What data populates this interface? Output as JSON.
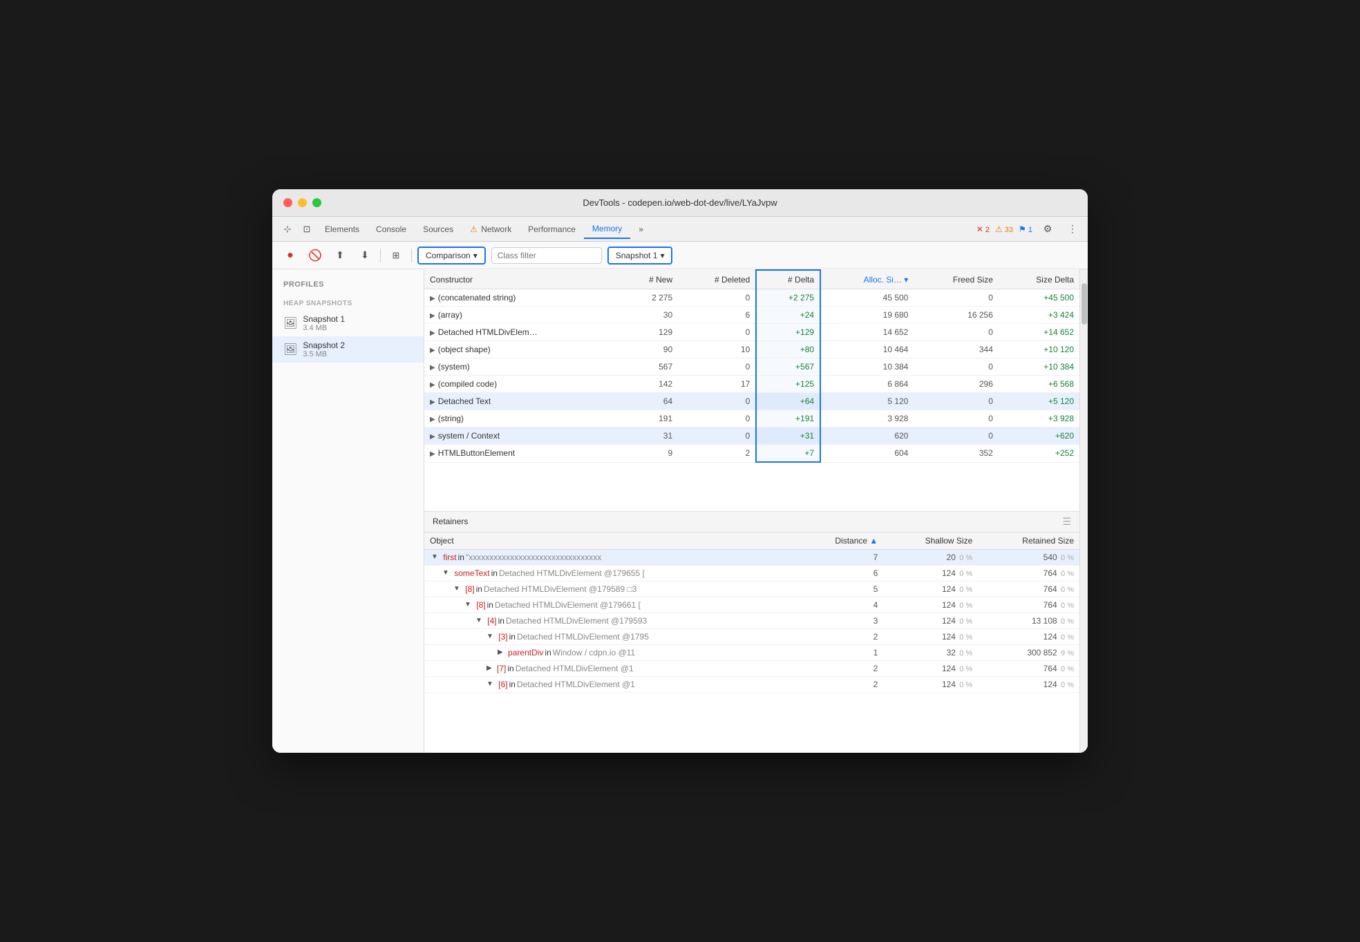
{
  "window": {
    "title": "DevTools - codepen.io/web-dot-dev/live/LYaJvpw"
  },
  "tabs": [
    {
      "label": "Elements",
      "active": false
    },
    {
      "label": "Console",
      "active": false
    },
    {
      "label": "Sources",
      "active": false
    },
    {
      "label": "Network",
      "active": false,
      "warn": true
    },
    {
      "label": "Performance",
      "active": false
    },
    {
      "label": "Memory",
      "active": true
    },
    {
      "label": "»",
      "active": false
    }
  ],
  "badges": {
    "errors": "2",
    "warnings": "33",
    "flags": "1"
  },
  "toolbar": {
    "comparison_label": "Comparison",
    "class_filter_placeholder": "Class filter",
    "snapshot_label": "Snapshot 1"
  },
  "profiles_title": "Profiles",
  "heap_snapshots_title": "HEAP SNAPSHOTS",
  "snapshots": [
    {
      "name": "Snapshot 1",
      "size": "3.4 MB"
    },
    {
      "name": "Snapshot 2",
      "size": "3.5 MB",
      "active": true
    }
  ],
  "main_table": {
    "columns": [
      "Constructor",
      "# New",
      "# Deleted",
      "# Delta",
      "Alloc. Si…",
      "Freed Size",
      "Size Delta"
    ],
    "rows": [
      {
        "constructor": "(concatenated string)",
        "new": "2 275",
        "deleted": "0",
        "delta": "+2 275",
        "alloc_size": "45 500",
        "freed_size": "0",
        "size_delta": "+45 500"
      },
      {
        "constructor": "(array)",
        "new": "30",
        "deleted": "6",
        "delta": "+24",
        "alloc_size": "19 680",
        "freed_size": "16 256",
        "size_delta": "+3 424"
      },
      {
        "constructor": "Detached HTMLDivElem…",
        "new": "129",
        "deleted": "0",
        "delta": "+129",
        "alloc_size": "14 652",
        "freed_size": "0",
        "size_delta": "+14 652"
      },
      {
        "constructor": "(object shape)",
        "new": "90",
        "deleted": "10",
        "delta": "+80",
        "alloc_size": "10 464",
        "freed_size": "344",
        "size_delta": "+10 120"
      },
      {
        "constructor": "(system)",
        "new": "567",
        "deleted": "0",
        "delta": "+567",
        "alloc_size": "10 384",
        "freed_size": "0",
        "size_delta": "+10 384"
      },
      {
        "constructor": "(compiled code)",
        "new": "142",
        "deleted": "17",
        "delta": "+125",
        "alloc_size": "6 864",
        "freed_size": "296",
        "size_delta": "+6 568"
      },
      {
        "constructor": "Detached Text",
        "new": "64",
        "deleted": "0",
        "delta": "+64",
        "alloc_size": "5 120",
        "freed_size": "0",
        "size_delta": "+5 120"
      },
      {
        "constructor": "(string)",
        "new": "191",
        "deleted": "0",
        "delta": "+191",
        "alloc_size": "3 928",
        "freed_size": "0",
        "size_delta": "+3 928"
      },
      {
        "constructor": "system / Context",
        "new": "31",
        "deleted": "0",
        "delta": "+31",
        "alloc_size": "620",
        "freed_size": "0",
        "size_delta": "+620"
      },
      {
        "constructor": "HTMLButtonElement",
        "new": "9",
        "deleted": "2",
        "delta": "+7",
        "alloc_size": "604",
        "freed_size": "352",
        "size_delta": "+252"
      }
    ]
  },
  "retainers": {
    "title": "Retainers",
    "columns": [
      "Object",
      "Distance",
      "Shallow Size",
      "Retained Size"
    ],
    "rows": [
      {
        "indent": 0,
        "type": "arrow",
        "key": "first",
        "middle": " in ",
        "context": "\"xxxxxxxxxxxxxxxxxxxxxxxxxxxxxxxx",
        "dist": "7",
        "shallow": "20",
        "shallow_pct": "0 %",
        "retained": "540",
        "retained_pct": "0 %"
      },
      {
        "indent": 1,
        "type": "arrow",
        "key": "someText",
        "middle": " in ",
        "context": "Detached HTMLDivElement @179655 [",
        "dist": "6",
        "shallow": "124",
        "shallow_pct": "0 %",
        "retained": "764",
        "retained_pct": "0 %"
      },
      {
        "indent": 2,
        "type": "arrow",
        "key": "[8]",
        "middle": " in ",
        "context": "Detached HTMLDivElement @179589 □3",
        "dist": "5",
        "shallow": "124",
        "shallow_pct": "0 %",
        "retained": "764",
        "retained_pct": "0 %"
      },
      {
        "indent": 3,
        "type": "arrow",
        "key": "[8]",
        "middle": " in ",
        "context": "Detached HTMLDivElement @179661 [",
        "dist": "4",
        "shallow": "124",
        "shallow_pct": "0 %",
        "retained": "764",
        "retained_pct": "0 %"
      },
      {
        "indent": 4,
        "type": "arrow",
        "key": "[4]",
        "middle": " in ",
        "context": "Detached HTMLDivElement @179593",
        "dist": "3",
        "shallow": "124",
        "shallow_pct": "0 %",
        "retained": "13 108",
        "retained_pct": "0 %"
      },
      {
        "indent": 5,
        "type": "arrow",
        "key": "[3]",
        "middle": " in ",
        "context": "Detached HTMLDivElement @1795",
        "dist": "2",
        "shallow": "124",
        "shallow_pct": "0 %",
        "retained": "124",
        "retained_pct": "0 %"
      },
      {
        "indent": 6,
        "type": "arrow_right",
        "key": "parentDiv",
        "middle": " in ",
        "context": "Window / cdpn.io @11",
        "dist": "1",
        "shallow": "32",
        "shallow_pct": "0 %",
        "retained": "300 852",
        "retained_pct": "9 %"
      },
      {
        "indent": 5,
        "type": "arrow_right",
        "key": "[7]",
        "middle": " in ",
        "context": "Detached HTMLDivElement @1",
        "dist": "2",
        "shallow": "124",
        "shallow_pct": "0 %",
        "retained": "764",
        "retained_pct": "0 %"
      },
      {
        "indent": 5,
        "type": "expand",
        "key": "[6]",
        "middle": " in ",
        "context": "Detached HTMLDivElement @1",
        "dist": "2",
        "shallow": "124",
        "shallow_pct": "0 %",
        "retained": "124",
        "retained_pct": "0 %"
      }
    ]
  }
}
